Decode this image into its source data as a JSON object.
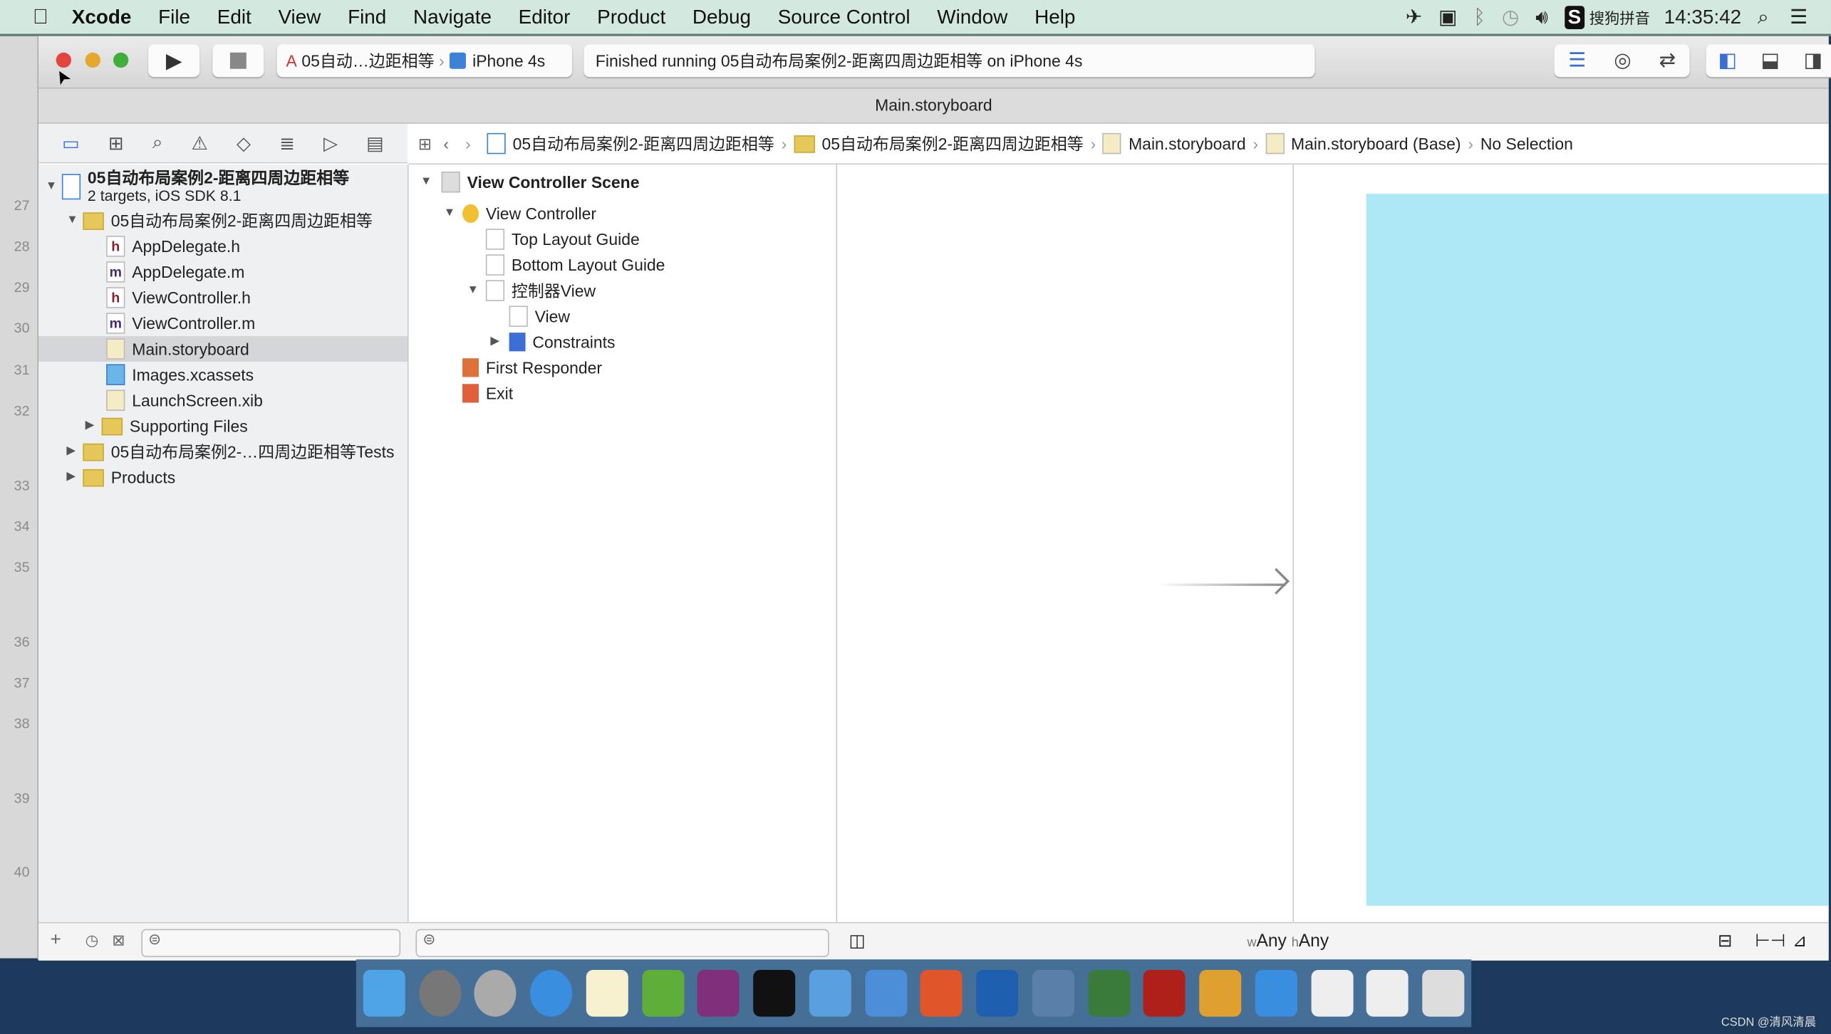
{
  "menubar": {
    "app": "Xcode",
    "items": [
      "File",
      "Edit",
      "View",
      "Find",
      "Navigate",
      "Editor",
      "Product",
      "Debug",
      "Source Control",
      "Window",
      "Help"
    ],
    "input_method": "搜狗拼音",
    "clock": "14:35:42"
  },
  "background_window": {
    "line_numbers": [
      "27",
      "28",
      "29",
      "30",
      "31",
      "32",
      "33",
      "34",
      "35",
      "36",
      "37",
      "38",
      "39",
      "40"
    ]
  },
  "toolbar": {
    "scheme": "05自动…边距相等",
    "device": "iPhone 4s",
    "status": "Finished running 05自动布局案例2-距离四周边距相等 on iPhone 4s"
  },
  "tab": {
    "title": "Main.storyboard"
  },
  "jumpbar": {
    "items": [
      "05自动布局案例2-距离四周边距相等",
      "05自动布局案例2-距离四周边距相等",
      "Main.storyboard",
      "Main.storyboard (Base)",
      "No Selection"
    ]
  },
  "navigator": {
    "project": {
      "name": "05自动布局案例2-距离四周边距相等",
      "subtitle": "2 targets, iOS SDK 8.1"
    },
    "items": [
      {
        "label": "05自动布局案例2-距离四周边距相等",
        "icon": "folder"
      },
      {
        "label": "AppDelegate.h",
        "icon": "h"
      },
      {
        "label": "AppDelegate.m",
        "icon": "m"
      },
      {
        "label": "ViewController.h",
        "icon": "h"
      },
      {
        "label": "ViewController.m",
        "icon": "m"
      },
      {
        "label": "Main.storyboard",
        "icon": "storyboard",
        "selected": true
      },
      {
        "label": "Images.xcassets",
        "icon": "xcassets"
      },
      {
        "label": "LaunchScreen.xib",
        "icon": "xib"
      },
      {
        "label": "Supporting Files",
        "icon": "folder"
      },
      {
        "label": "05自动布局案例2-…四周边距相等Tests",
        "icon": "folder"
      },
      {
        "label": "Products",
        "icon": "folder"
      }
    ]
  },
  "outline": {
    "items": [
      "View Controller Scene",
      "View Controller",
      "Top Layout Guide",
      "Bottom Layout Guide",
      "控制器View",
      "View",
      "Constraints",
      "First Responder",
      "Exit"
    ]
  },
  "canvas": {
    "view_color": "#aee8f7",
    "size_class": {
      "w_prefix": "w",
      "w": "Any",
      "h_prefix": "h",
      "h": "Any"
    }
  },
  "watermark": "CSDN @清风清晨",
  "colors": {
    "menubar": "#d3e8df",
    "dock": "#466f98",
    "close": "#e2463f",
    "minimize": "#e5a72d",
    "zoom": "#3fae3a"
  }
}
